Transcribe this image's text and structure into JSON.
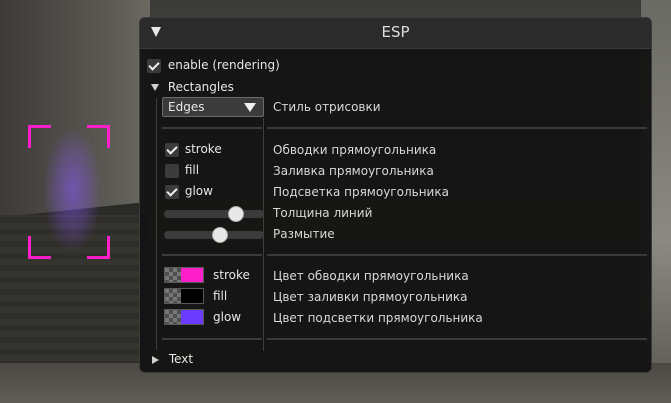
{
  "window": {
    "title": "ESP"
  },
  "enable": {
    "label": "enable (rendering)",
    "checked": true
  },
  "rectangles": {
    "header": "Rectangles",
    "style": {
      "value": "Edges",
      "description": "Стиль отрисовки"
    },
    "checkboxes": [
      {
        "label": "stroke",
        "checked": true,
        "description": "Обводки прямоугольника"
      },
      {
        "label": "fill",
        "checked": false,
        "description": "Заливка прямоугольника"
      },
      {
        "label": "glow",
        "checked": true,
        "description": "Подсветка прямоугольника"
      }
    ],
    "sliders": [
      {
        "value_fraction": 0.72,
        "description": "Толщина линий"
      },
      {
        "value_fraction": 0.56,
        "description": "Размытие"
      }
    ],
    "colors": [
      {
        "label": "stroke",
        "color": "#ff1fc8",
        "description": "Цвет обводки прямоугольника"
      },
      {
        "label": "fill",
        "color": "#000000",
        "description": "Цвет заливки прямоугольника"
      },
      {
        "label": "glow",
        "color": "#6a3cff",
        "description": "Цвет подсветки прямоугольника"
      }
    ]
  },
  "text_section": {
    "header": "Text"
  },
  "colors": {
    "esp_box": "#ff1fc8",
    "esp_glow": "#8c5aff",
    "panel_bg": "#141414"
  }
}
